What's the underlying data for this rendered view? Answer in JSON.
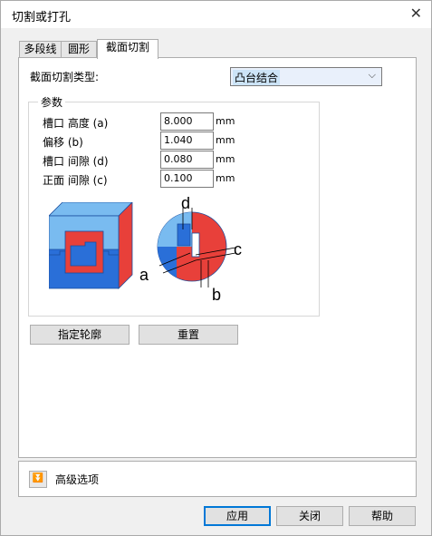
{
  "window": {
    "title": "切割或打孔",
    "close_glyph": "✕"
  },
  "tabs": [
    {
      "label": "多段线",
      "active": false
    },
    {
      "label": "圆形",
      "active": false
    },
    {
      "label": "截面切割",
      "active": true
    }
  ],
  "cut_type": {
    "label": "截面切割类型:",
    "value": "凸台结合",
    "arrow": "⌵"
  },
  "params": {
    "title": "参数",
    "rows": [
      {
        "label": "槽口 高度 (a)",
        "value": "8.000",
        "unit": "mm"
      },
      {
        "label": "偏移 (b)",
        "value": "1.040",
        "unit": "mm"
      },
      {
        "label": "槽口 间隙 (d)",
        "value": "0.080",
        "unit": "mm"
      },
      {
        "label": "正面 间隙 (c)",
        "value": "0.100",
        "unit": "mm"
      }
    ]
  },
  "diagram": {
    "labels": {
      "a": "a",
      "b": "b",
      "c": "c",
      "d": "d"
    }
  },
  "buttons": {
    "specify_contour": "指定轮廓",
    "reset": "重置"
  },
  "advanced": {
    "label": "高级选项",
    "icon": "expand-icon"
  },
  "footer": {
    "apply": "应用",
    "close": "关闭",
    "help": "帮助"
  },
  "colors": {
    "red": "#e8403a",
    "blue": "#2a6fd8",
    "light_blue": "#79bbf0",
    "accent": "#0078d7"
  }
}
